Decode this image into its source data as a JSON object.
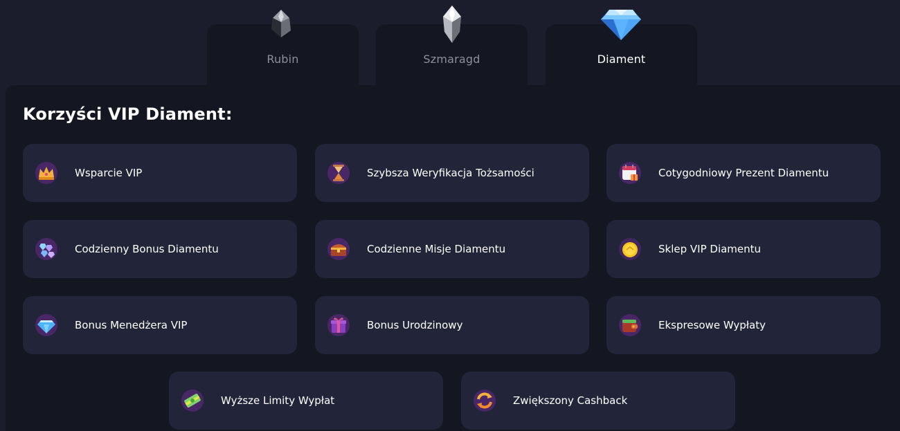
{
  "tabs": [
    {
      "label": "Rubin",
      "icon": "crystal-dark-icon",
      "active": false
    },
    {
      "label": "Szmaragd",
      "icon": "crystal-silver-icon",
      "active": false
    },
    {
      "label": "Diament",
      "icon": "diamond-blue-icon",
      "active": true
    }
  ],
  "section": {
    "title": "Korzyści VIP Diament:"
  },
  "benefits": [
    {
      "label": "Wsparcie VIP",
      "icon": "crown-icon"
    },
    {
      "label": "Szybsza Weryfikacja Tożsamości",
      "icon": "hourglass-icon"
    },
    {
      "label": "Cotygodniowy Prezent Diamentu",
      "icon": "calendar-gift-icon"
    },
    {
      "label": "Codzienny Bonus Diamentu",
      "icon": "gems-pile-icon"
    },
    {
      "label": "Codzienne Misje Diamentu",
      "icon": "treasure-chest-icon"
    },
    {
      "label": "Sklep VIP Diamentu",
      "icon": "gold-coin-icon"
    },
    {
      "label": "Bonus Menedżera VIP",
      "icon": "diamond-icon"
    },
    {
      "label": "Bonus Urodzinowy",
      "icon": "gift-box-icon"
    },
    {
      "label": "Ekspresowe Wypłaty",
      "icon": "wallet-icon"
    },
    {
      "label": "Wyższe Limity Wypłat",
      "icon": "cash-stack-icon"
    },
    {
      "label": "Zwiększony Cashback",
      "icon": "cashback-arrows-icon"
    }
  ],
  "colors": {
    "background": "#1b1d2c",
    "panel": "#141622",
    "card": "#222539",
    "text_active": "#ffffff",
    "text_inactive": "#8d8f9c"
  }
}
